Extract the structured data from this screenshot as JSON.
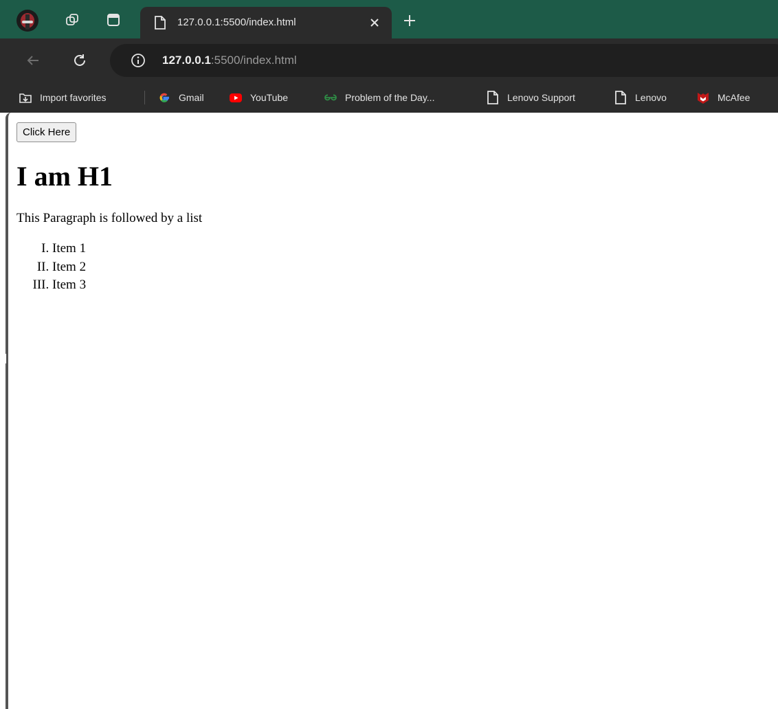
{
  "browser": {
    "tab": {
      "title": "127.0.0.1:5500/index.html"
    },
    "address_bar": {
      "host": "127.0.0.1",
      "path": ":5500/index.html"
    },
    "bookmarks": [
      {
        "label": "Import favorites",
        "icon": "import-favorites-icon"
      },
      {
        "label": "Gmail",
        "icon": "google-icon"
      },
      {
        "label": "YouTube",
        "icon": "youtube-icon"
      },
      {
        "label": "Problem of the Day...",
        "icon": "gfg-icon"
      },
      {
        "label": "Lenovo Support",
        "icon": "page-icon"
      },
      {
        "label": "Lenovo",
        "icon": "page-icon"
      },
      {
        "label": "McAfee",
        "icon": "mcafee-icon"
      }
    ],
    "colors": {
      "tabstrip": "#1d5b48",
      "toolbar": "#2b2b2b"
    }
  },
  "page": {
    "button_label": "Click Here",
    "heading": "I am H1",
    "paragraph": "This Paragraph is followed by a list",
    "list_items": [
      "Item 1",
      "Item 2",
      "Item 3"
    ]
  }
}
